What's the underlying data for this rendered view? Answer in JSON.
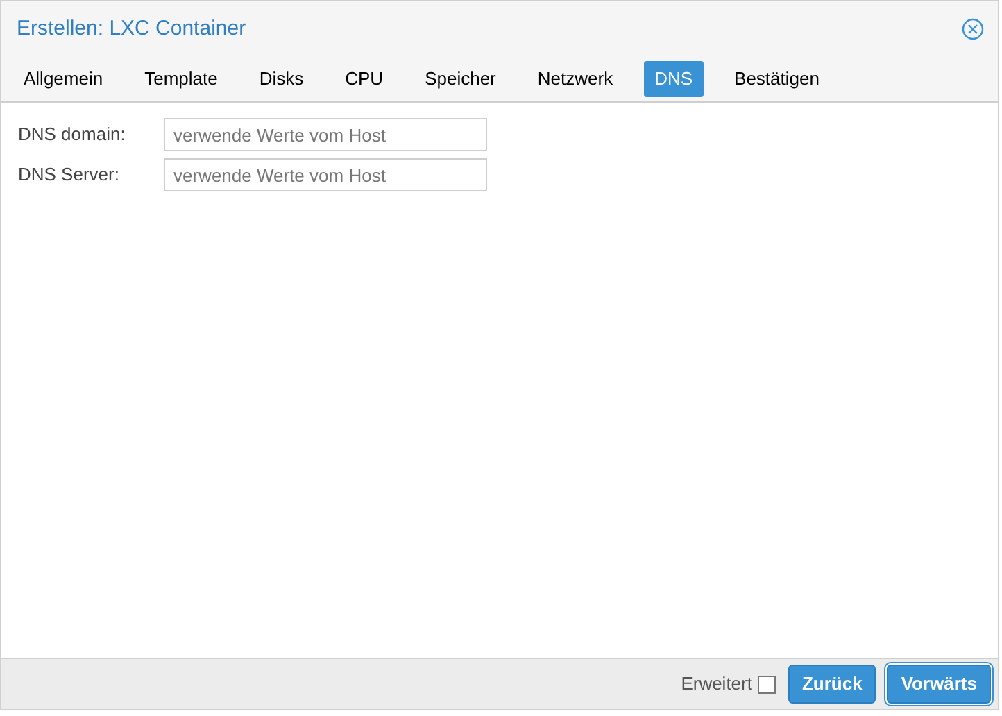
{
  "window": {
    "title": "Erstellen: LXC Container"
  },
  "tabs": [
    {
      "label": "Allgemein",
      "selected": false
    },
    {
      "label": "Template",
      "selected": false
    },
    {
      "label": "Disks",
      "selected": false
    },
    {
      "label": "CPU",
      "selected": false
    },
    {
      "label": "Speicher",
      "selected": false
    },
    {
      "label": "Netzwerk",
      "selected": false
    },
    {
      "label": "DNS",
      "selected": true
    },
    {
      "label": "Bestätigen",
      "selected": false
    }
  ],
  "fields": [
    {
      "label": "DNS domain:",
      "placeholder": "verwende Werte vom Host"
    },
    {
      "label": "DNS Server:",
      "placeholder": "verwende Werte vom Host"
    }
  ],
  "footer": {
    "advanced": {
      "label": "Erweitert",
      "checked": false
    },
    "buttons": [
      {
        "label": "Zurück",
        "focused": false
      },
      {
        "label": "Vorwärts",
        "focused": true
      }
    ]
  }
}
